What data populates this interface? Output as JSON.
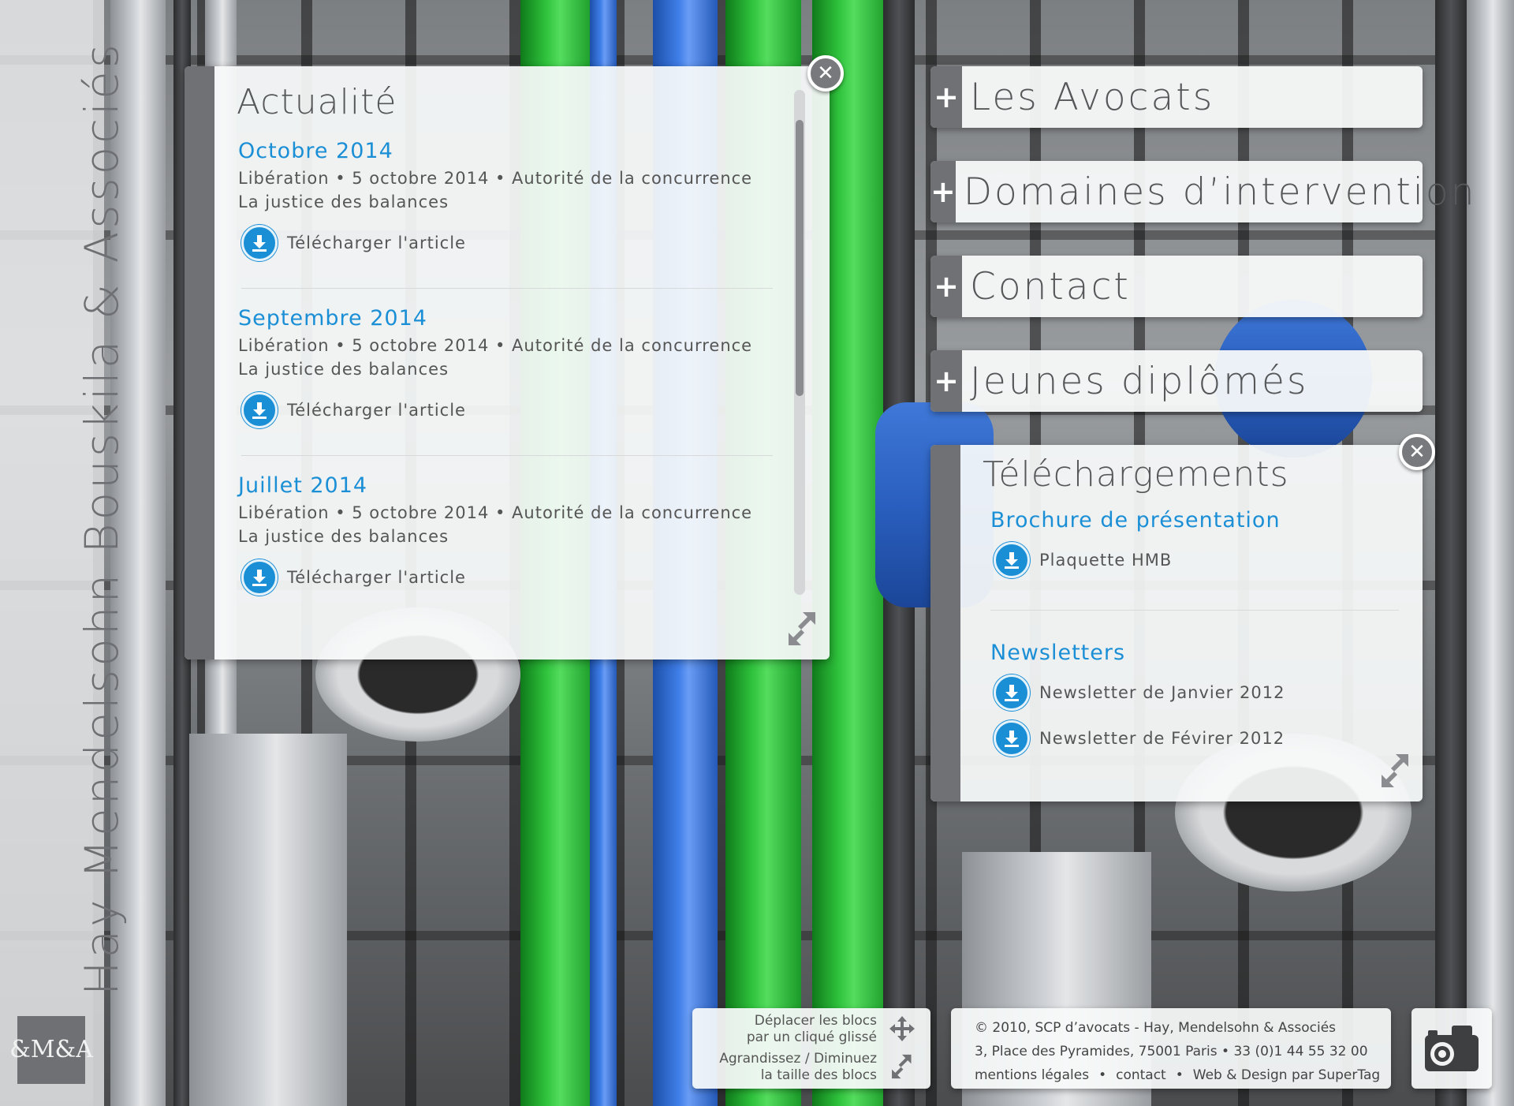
{
  "brand": {
    "name": "Hay Mendelsohn Bouskila & Associés",
    "logo_text": "&M&A"
  },
  "news_panel": {
    "title": "Actualité",
    "items": [
      {
        "month": "Octobre 2014",
        "meta": "Libération • 5 octobre 2014 • Autorité de la concurrence",
        "headline": "La justice des balances",
        "download_label": "Télécharger l'article"
      },
      {
        "month": "Septembre 2014",
        "meta": "Libération • 5 octobre 2014 • Autorité de la concurrence",
        "headline": "La justice des balances",
        "download_label": "Télécharger l'article"
      },
      {
        "month": "Juillet 2014",
        "meta": "Libération • 5 octobre 2014 • Autorité de la concurrence",
        "headline": "La justice des balances",
        "download_label": "Télécharger l'article"
      }
    ]
  },
  "menu": {
    "items": [
      {
        "label": "Les Avocats"
      },
      {
        "label": "Domaines d’intervention"
      },
      {
        "label": "Contact"
      },
      {
        "label": "Jeunes diplômés"
      }
    ]
  },
  "downloads_panel": {
    "title": "Téléchargements",
    "sections": [
      {
        "heading": "Brochure de présentation",
        "files": [
          "Plaquette HMB"
        ]
      },
      {
        "heading": "Newsletters",
        "files": [
          "Newsletter de Janvier 2012",
          "Newsletter de Févirer 2012"
        ]
      }
    ]
  },
  "help": {
    "move_line1": "Déplacer les blocs",
    "move_line2": "par un cliqué glissé",
    "resize_line1": "Agrandissez / Diminuez",
    "resize_line2": "la taille des blocs"
  },
  "footer": {
    "copyright": "© 2010, SCP d’avocats - Hay, Mendelsohn & Associés",
    "address": "3, Place des Pyramides, 75001 Paris • 33 (0)1 44 55 32 00",
    "legal_link": "mentions légales",
    "contact_link": "contact",
    "credit_link": "Web & Design par SuperTag",
    "separator": "•"
  },
  "colors": {
    "accent": "#1b8fd6",
    "panel_bar": "#6f7174"
  }
}
